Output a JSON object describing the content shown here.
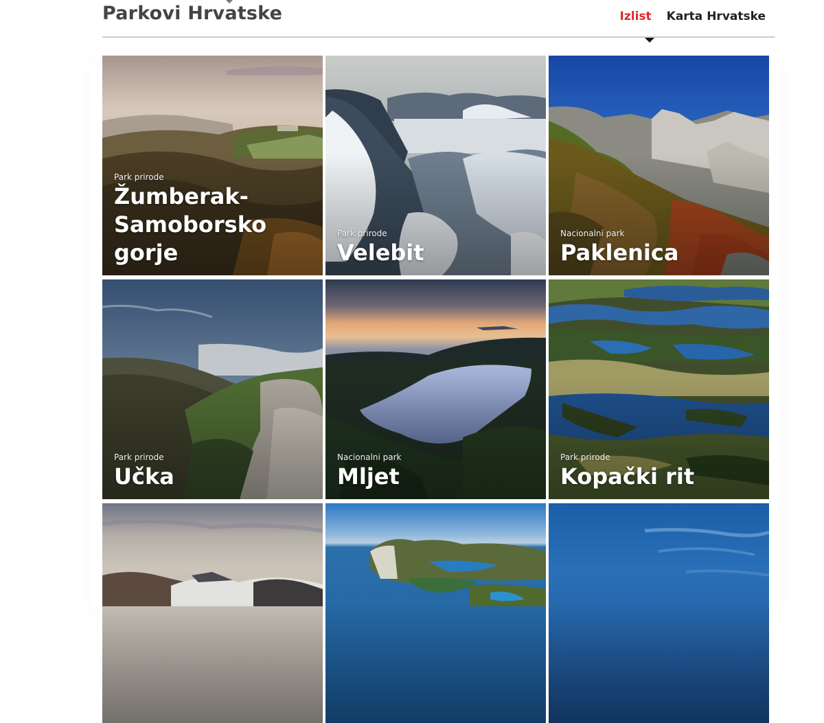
{
  "header": {
    "title": "Parkovi Hrvatske",
    "nav": [
      {
        "label": "Izlist",
        "active": true
      },
      {
        "label": "Karta Hrvatske",
        "active": false
      }
    ]
  },
  "colors": {
    "accent": "#e0262d",
    "title": "#444444",
    "rule": "#cccccc"
  },
  "parks": [
    {
      "type": "Park prirode",
      "name": "Žumberak-Samoborsko gorje",
      "image": "hazy-hills-sunrise-photo"
    },
    {
      "type": "Park prirode",
      "name": "Velebit",
      "image": "snowy-mountains-photo"
    },
    {
      "type": "Nacionalni park",
      "name": "Paklenica",
      "image": "rocky-peaks-autumn-photo"
    },
    {
      "type": "Park prirode",
      "name": "Učka",
      "image": "mountain-ridge-clouds-photo"
    },
    {
      "type": "Nacionalni park",
      "name": "Mljet",
      "image": "lake-sunset-photo"
    },
    {
      "type": "Park prirode",
      "name": "Kopački rit",
      "image": "wetland-aerial-photo"
    },
    {
      "type": "",
      "name": "",
      "image": "misty-hills-photo"
    },
    {
      "type": "",
      "name": "",
      "image": "island-coast-aerial-photo"
    },
    {
      "type": "",
      "name": "",
      "image": "blue-sea-photo"
    }
  ]
}
